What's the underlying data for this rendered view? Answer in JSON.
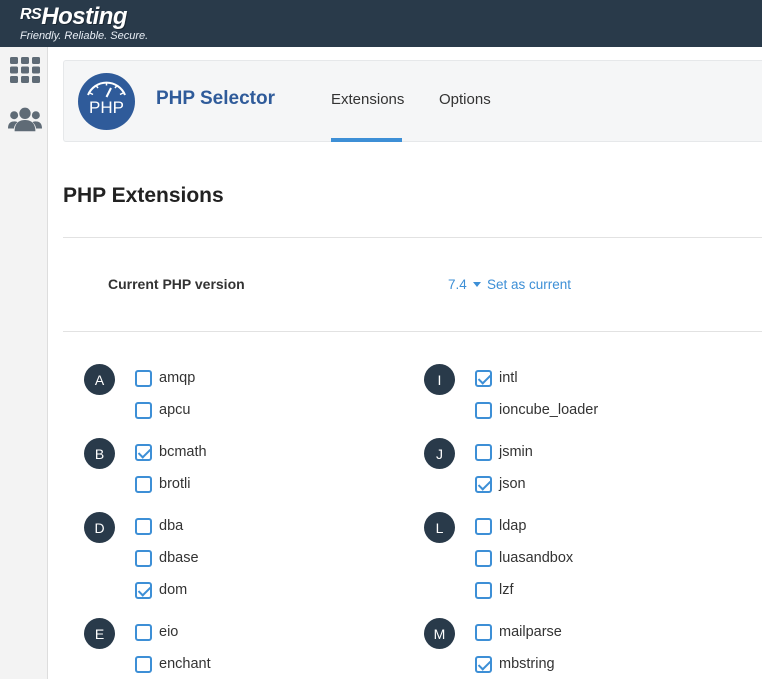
{
  "brand": {
    "name_prefix": "RS",
    "name_main": "Hosting",
    "tagline": "Friendly. Reliable. Secure."
  },
  "sidebar": {
    "icons": [
      "apps-grid-icon",
      "users-icon"
    ]
  },
  "app": {
    "logo_text": "PHP",
    "title": "PHP Selector",
    "tabs": [
      {
        "label": "Extensions",
        "active": true
      },
      {
        "label": "Options",
        "active": false
      }
    ]
  },
  "page": {
    "heading": "PHP Extensions"
  },
  "version": {
    "label": "Current PHP version",
    "value": "7.4",
    "action": "Set as current"
  },
  "colors": {
    "topbar": "#293a4a",
    "accent": "#3d8fd6",
    "title": "#2f5b9a"
  },
  "extensions": {
    "left": [
      {
        "letter": "A",
        "items": [
          {
            "name": "amqp",
            "checked": false
          },
          {
            "name": "apcu",
            "checked": false
          }
        ]
      },
      {
        "letter": "B",
        "items": [
          {
            "name": "bcmath",
            "checked": true
          },
          {
            "name": "brotli",
            "checked": false
          }
        ]
      },
      {
        "letter": "D",
        "items": [
          {
            "name": "dba",
            "checked": false
          },
          {
            "name": "dbase",
            "checked": false
          },
          {
            "name": "dom",
            "checked": true
          }
        ]
      },
      {
        "letter": "E",
        "items": [
          {
            "name": "eio",
            "checked": false
          },
          {
            "name": "enchant",
            "checked": false
          }
        ]
      }
    ],
    "right": [
      {
        "letter": "I",
        "items": [
          {
            "name": "intl",
            "checked": true
          },
          {
            "name": "ioncube_loader",
            "checked": false
          }
        ]
      },
      {
        "letter": "J",
        "items": [
          {
            "name": "jsmin",
            "checked": false
          },
          {
            "name": "json",
            "checked": true
          }
        ]
      },
      {
        "letter": "L",
        "items": [
          {
            "name": "ldap",
            "checked": false
          },
          {
            "name": "luasandbox",
            "checked": false
          },
          {
            "name": "lzf",
            "checked": false
          }
        ]
      },
      {
        "letter": "M",
        "items": [
          {
            "name": "mailparse",
            "checked": false
          },
          {
            "name": "mbstring",
            "checked": true
          }
        ]
      }
    ]
  }
}
